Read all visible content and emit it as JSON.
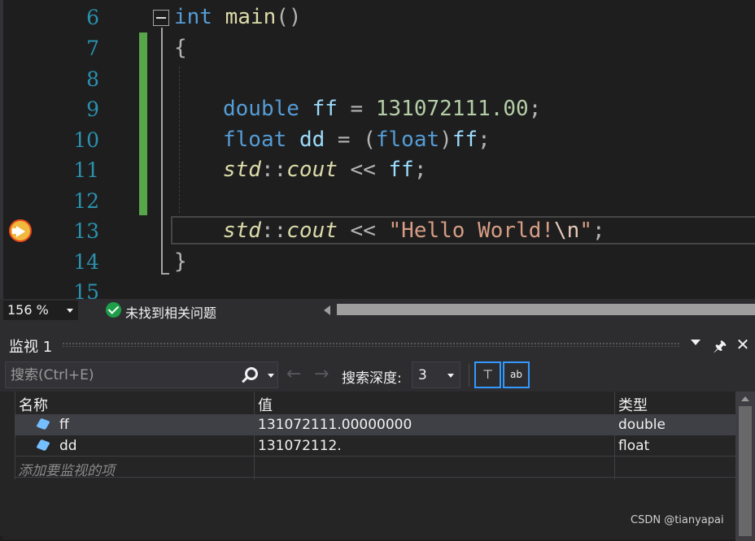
{
  "editor": {
    "line_numbers": [
      "6",
      "7",
      "8",
      "9",
      "10",
      "11",
      "12",
      "13",
      "14",
      "15"
    ],
    "code": {
      "l6_kw": "int",
      "l6_fn": "main",
      "l6_paren": "()",
      "l7": "{",
      "l9_type": "double",
      "l9_var": "ff",
      "l9_eq": " = ",
      "l9_num": "131072111.00",
      "l9_end": ";",
      "l10_type": "float",
      "l10_var": "dd",
      "l10_eq": " = ",
      "l10_cast_open": "(",
      "l10_cast": "float",
      "l10_cast_close": ")",
      "l10_var2": "ff",
      "l10_end": ";",
      "l11_ns": "std",
      "l11_sep": "::",
      "l11_obj": "cout",
      "l11_op": " << ",
      "l11_var": "ff",
      "l11_end": ";",
      "l13_ns": "std",
      "l13_sep": "::",
      "l13_obj": "cout",
      "l13_op": " << ",
      "l13_str": "\"Hello World!",
      "l13_esc": "\\n",
      "l13_strend": "\"",
      "l13_end": ";",
      "l14": "}"
    },
    "status": {
      "zoom": "156 %",
      "issues": "未找到相关问题"
    }
  },
  "watch": {
    "title": "监视 1",
    "search_placeholder": "搜索(Ctrl+E)",
    "depth_label": "搜索深度:",
    "depth_value": "3",
    "filter_button_glyph": "⊤",
    "hex_button_glyph": "ab",
    "columns": {
      "name": "名称",
      "value": "值",
      "type": "类型"
    },
    "rows": [
      {
        "name": "ff",
        "value": "131072111.00000000",
        "type": "double"
      },
      {
        "name": "dd",
        "value": "131072112.",
        "type": "float"
      }
    ],
    "add_placeholder": "添加要监视的项"
  },
  "watermark": "CSDN @tianyapai",
  "colors": {
    "keyword": "#569cd6",
    "line_number": "#2b91af",
    "change_bar": "#57a64a",
    "accent": "#3399ff"
  },
  "icons": [
    "execution-pointer-icon",
    "collapse-icon",
    "check-circle-icon",
    "search-icon",
    "back-arrow-icon",
    "forward-arrow-icon",
    "pin-icon",
    "close-icon",
    "variable-icon"
  ]
}
